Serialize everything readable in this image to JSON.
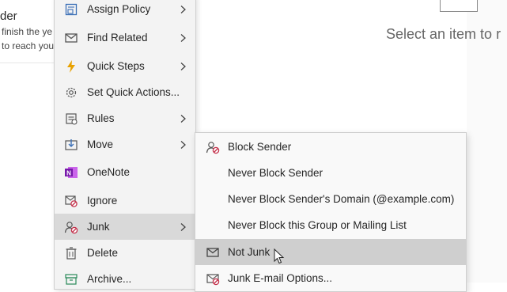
{
  "email_list": {
    "sender": "der",
    "preview_line1": "finish the ye",
    "preview_line2": "to reach you"
  },
  "reading_pane": {
    "message": "Select an item to r"
  },
  "context_menu": {
    "items": [
      {
        "label": "Assign Policy",
        "icon": "assign-policy-icon",
        "has_submenu": true
      },
      {
        "label": "Find Related",
        "icon": "find-related-icon",
        "has_submenu": true
      },
      {
        "label": "Quick Steps",
        "icon": "lightning-icon",
        "has_submenu": true
      },
      {
        "label": "Set Quick Actions...",
        "icon": "gear-icon",
        "has_submenu": false
      },
      {
        "label": "Rules",
        "icon": "rules-icon",
        "has_submenu": true
      },
      {
        "label": "Move",
        "icon": "move-icon",
        "has_submenu": true
      },
      {
        "label": "OneNote",
        "icon": "onenote-icon",
        "has_submenu": false
      },
      {
        "label": "Ignore",
        "icon": "ignore-icon",
        "has_submenu": false
      },
      {
        "label": "Junk",
        "icon": "junk-icon",
        "has_submenu": true,
        "active": true
      },
      {
        "label": "Delete",
        "icon": "trash-icon",
        "has_submenu": false
      },
      {
        "label": "Archive...",
        "icon": "archive-icon",
        "has_submenu": false
      }
    ]
  },
  "junk_submenu": {
    "items": [
      {
        "label": "Block Sender",
        "icon": "block-sender-icon"
      },
      {
        "label": "Never Block Sender",
        "icon": ""
      },
      {
        "label": "Never Block Sender's Domain (@example.com)",
        "icon": ""
      },
      {
        "label": "Never Block this Group or Mailing List",
        "icon": ""
      },
      {
        "label": "Not Junk",
        "icon": "envelope-icon",
        "hover": true
      },
      {
        "label": "Junk E-mail Options...",
        "icon": "junk-options-icon"
      }
    ]
  },
  "colors": {
    "menu_bg": "#f3f3f3",
    "menu_active": "#d9d9d9",
    "submenu_hover": "#cfcfcf",
    "accent_orange": "#d38b00",
    "onenote_purple": "#7719aa",
    "block_red": "#c4314b"
  }
}
